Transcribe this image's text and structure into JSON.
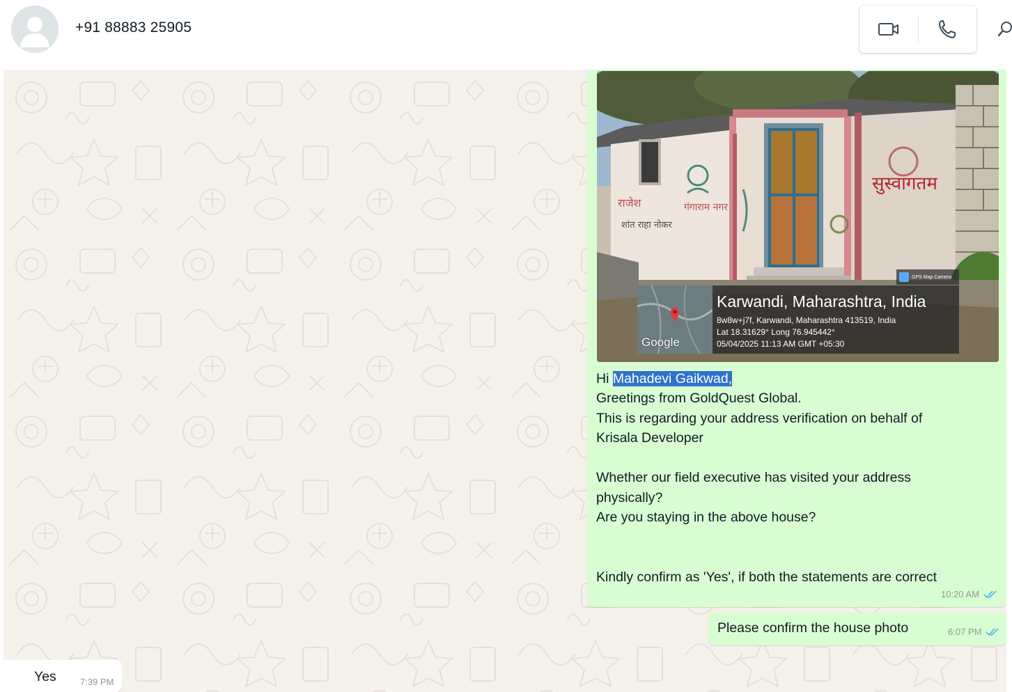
{
  "header": {
    "contact_name": "+91 88883 25905"
  },
  "messages": {
    "sent_main": {
      "photo": {
        "wall_text_1": "सुस्वागतम",
        "wall_text_2": "राजेश",
        "wall_text_3": "गंगाराम नगर",
        "wall_text_4": "शांत राहा नोकर",
        "map_label": "Google",
        "gps_badge": "GPS Map Camera",
        "location_title": "Karwandi, Maharashtra, India",
        "address_line": "8w8w+j7f, Karwandi, Maharashtra 413519, India",
        "coords_line": "Lat 18.31629° Long 76.945442°",
        "timestamp_line": "05/04/2025 11:13 AM GMT +05:30"
      },
      "greeting_prefix": "Hi ",
      "greeting_name": "Mahadevi Gaikwad,",
      "line_2": "Greetings from GoldQuest Global.",
      "line_3": "This is regarding your address verification on behalf of",
      "line_4": "Krisala Developer",
      "line_5": "Whether our field executive has visited your address",
      "line_6": "physically?",
      "line_7": "Are you staying in the above house?",
      "line_8": "Kindly confirm as 'Yes', if both the statements are correct",
      "time": "10:20 AM"
    },
    "sent_followup": {
      "text": "Please confirm the house photo",
      "time": "6:07 PM"
    },
    "received_reply": {
      "text": "Yes",
      "time": "7:39 PM"
    }
  },
  "colors": {
    "sent_bubble": "#d9fdd3",
    "received_bubble": "#ffffff",
    "chat_background": "#f5f1eb",
    "read_tick": "#53bdeb",
    "selection_highlight": "#2f73c8"
  }
}
